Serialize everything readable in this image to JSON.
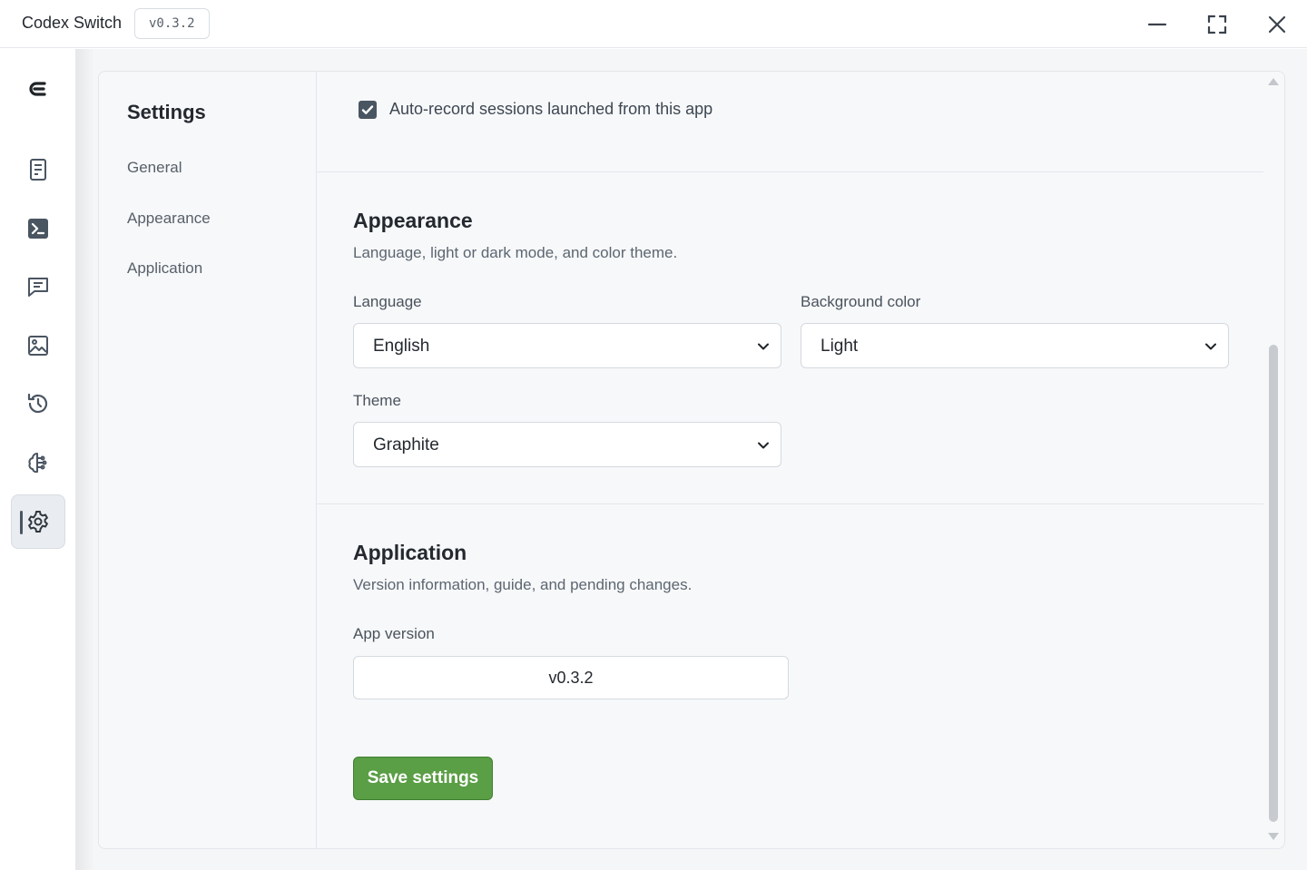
{
  "titlebar": {
    "app_title": "Codex Switch",
    "version_badge": "v0.3.2"
  },
  "rail": {
    "icons": [
      "logo-icon",
      "document-icon",
      "terminal-icon",
      "chat-icon",
      "image-icon",
      "history-icon",
      "brain-icon",
      "settings-icon"
    ],
    "active": "settings-icon"
  },
  "settings_nav": {
    "title": "Settings",
    "items": [
      "General",
      "Appearance",
      "Application"
    ]
  },
  "content": {
    "auto_record": {
      "label": "Auto-record sessions launched from this app",
      "checked": true
    },
    "appearance": {
      "title": "Appearance",
      "description": "Language, light or dark mode, and color theme.",
      "language": {
        "label": "Language",
        "value": "English"
      },
      "background": {
        "label": "Background color",
        "value": "Light"
      },
      "theme": {
        "label": "Theme",
        "value": "Graphite"
      }
    },
    "application": {
      "title": "Application",
      "description": "Version information, guide, and pending changes.",
      "version_label": "App version",
      "version_value": "v0.3.2",
      "save_label": "Save settings"
    }
  },
  "colors": {
    "accent_green": "#5a9e45",
    "checkbox": "#4a5562",
    "panel_bg": "#f7f8fa"
  }
}
